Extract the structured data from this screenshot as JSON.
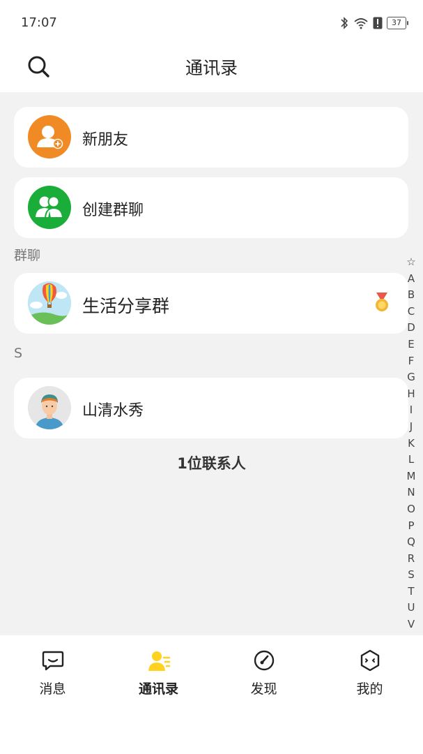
{
  "status_bar": {
    "time": "17:07",
    "battery": "37"
  },
  "header": {
    "title": "通讯录"
  },
  "entries": {
    "new_friends": "新朋友",
    "create_group": "创建群聊"
  },
  "groups_section": {
    "label": "群聊",
    "items": [
      {
        "name": "生活分享群"
      }
    ]
  },
  "contacts_section": {
    "letter": "S",
    "items": [
      {
        "name": "山清水秀"
      }
    ]
  },
  "contact_count": "1位联系人",
  "alpha_index": [
    "☆",
    "A",
    "B",
    "C",
    "D",
    "E",
    "F",
    "G",
    "H",
    "I",
    "J",
    "K",
    "L",
    "M",
    "N",
    "O",
    "P",
    "Q",
    "R",
    "S",
    "T",
    "U",
    "V"
  ],
  "tabs": [
    {
      "label": "消息",
      "icon": "message-icon",
      "active": false
    },
    {
      "label": "通讯录",
      "icon": "contacts-icon",
      "active": true
    },
    {
      "label": "发现",
      "icon": "compass-icon",
      "active": false
    },
    {
      "label": "我的",
      "icon": "profile-face-icon",
      "active": false
    }
  ],
  "colors": {
    "orange": "#f08a24",
    "green": "#1aad3a",
    "accent_yellow": "#ffd21f"
  }
}
